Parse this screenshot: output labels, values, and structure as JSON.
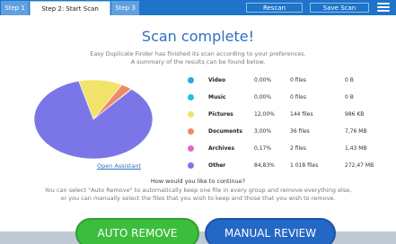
{
  "header": {
    "tabs": [
      {
        "label": "Step 1"
      },
      {
        "label": "Step 2: Start Scan"
      },
      {
        "label": "Step 3"
      }
    ],
    "rescan_label": "Rescan",
    "save_scan_label": "Save Scan"
  },
  "main": {
    "title": "Scan complete!",
    "subtitle_line1": "Easy Duplicate Finder has finished its scan according to your preferences.",
    "subtitle_line2": "A summary of the results can be found below.",
    "open_assistant_label": "Open Assistant",
    "question": "How would you like to continue?",
    "description_line1": "You can select \"Auto Remove\" to automatically keep one file in every group and remove everything else,",
    "description_line2": "or you can manually select the files that you wish to keep and those that you wish to remove."
  },
  "stats": [
    {
      "category": "Video",
      "percent": "0,00%",
      "files": "0 files",
      "size": "0 B",
      "color": "#29a8e0"
    },
    {
      "category": "Music",
      "percent": "0,00%",
      "files": "0 files",
      "size": "0 B",
      "color": "#22c2d6"
    },
    {
      "category": "Pictures",
      "percent": "12,00%",
      "files": "144 files",
      "size": "986 KB",
      "color": "#f2e36a"
    },
    {
      "category": "Documents",
      "percent": "3,00%",
      "files": "36 files",
      "size": "7,76 MB",
      "color": "#ee8a6a"
    },
    {
      "category": "Archives",
      "percent": "0,17%",
      "files": "2 files",
      "size": "1,43 MB",
      "color": "#e068c8"
    },
    {
      "category": "Other",
      "percent": "84,83%",
      "files": "1 018 files",
      "size": "272,47 MB",
      "color": "#7b76e8"
    }
  ],
  "chart_data": {
    "type": "pie",
    "labels": [
      "Video",
      "Music",
      "Pictures",
      "Documents",
      "Archives",
      "Other"
    ],
    "values": [
      0.0,
      0.0,
      12.0,
      3.0,
      0.17,
      84.83
    ],
    "colors": [
      "#29a8e0",
      "#22c2d6",
      "#f2e36a",
      "#ee8a6a",
      "#e068c8",
      "#7b76e8"
    ]
  },
  "actions": {
    "auto_remove_label": "AUTO REMOVE",
    "manual_review_label": "MANUAL REVIEW"
  }
}
